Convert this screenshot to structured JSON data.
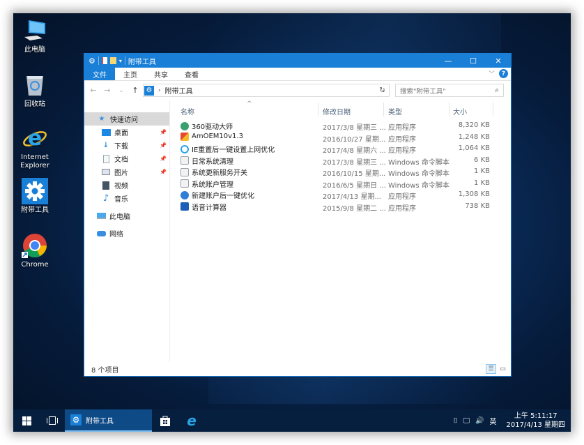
{
  "desktop": {
    "icons": [
      {
        "label": "此电脑",
        "icon": "computer-icon"
      },
      {
        "label": "回收站",
        "icon": "recycle-bin-icon"
      },
      {
        "label": "Internet Explorer",
        "icon": "internet-explorer-icon"
      },
      {
        "label": "附带工具",
        "icon": "gear-icon"
      },
      {
        "label": "Chrome",
        "icon": "chrome-icon"
      }
    ]
  },
  "window": {
    "title": "附带工具",
    "controls": {
      "minimize": "—",
      "maximize": "☐",
      "close": "✕"
    },
    "ribbon_tabs": [
      "文件",
      "主页",
      "共享",
      "查看"
    ],
    "address": {
      "path": [
        "附带工具"
      ],
      "search_placeholder": "搜索\"附带工具\""
    },
    "nav_pane": {
      "items": [
        {
          "label": "快速访问",
          "icon": "star-icon",
          "selected": true,
          "pinned": false
        },
        {
          "label": "桌面",
          "icon": "desktop-icon",
          "pinned": true
        },
        {
          "label": "下载",
          "icon": "download-icon",
          "pinned": true
        },
        {
          "label": "文档",
          "icon": "document-icon",
          "pinned": true
        },
        {
          "label": "图片",
          "icon": "picture-icon",
          "pinned": true
        },
        {
          "label": "视频",
          "icon": "video-icon",
          "pinned": false
        },
        {
          "label": "音乐",
          "icon": "music-icon",
          "pinned": false
        },
        {
          "label": "此电脑",
          "icon": "computer-icon",
          "pinned": false
        },
        {
          "label": "网络",
          "icon": "network-icon",
          "pinned": false
        }
      ]
    },
    "columns": {
      "name": "名称",
      "date": "修改日期",
      "type": "类型",
      "size": "大小"
    },
    "files": [
      {
        "name": "360驱动大师",
        "date": "2017/3/8 星期三 ...",
        "type": "应用程序",
        "size": "8,320 KB",
        "icon": "driver-app-icon"
      },
      {
        "name": "AmOEM10v1.3",
        "date": "2016/10/27 星期...",
        "type": "应用程序",
        "size": "1,248 KB",
        "icon": "oem-app-icon"
      },
      {
        "name": "IE重置后一键设置上网优化",
        "date": "2017/4/8 星期六 ...",
        "type": "应用程序",
        "size": "1,064 KB",
        "icon": "ie-app-icon"
      },
      {
        "name": "日常系统清理",
        "date": "2017/3/8 星期三 ...",
        "type": "Windows 命令脚本",
        "size": "6 KB",
        "icon": "script-icon"
      },
      {
        "name": "系统更新服务开关",
        "date": "2016/10/15 星期...",
        "type": "Windows 命令脚本",
        "size": "1 KB",
        "icon": "script-icon"
      },
      {
        "name": "系统账户管理",
        "date": "2016/6/5 星期日 ...",
        "type": "Windows 命令脚本",
        "size": "1 KB",
        "icon": "script-icon"
      },
      {
        "name": "新建账户后一键优化",
        "date": "2017/4/13 星期...",
        "type": "应用程序",
        "size": "1,308 KB",
        "icon": "account-app-icon"
      },
      {
        "name": "语音计算器",
        "date": "2015/9/8 星期二 ...",
        "type": "应用程序",
        "size": "738 KB",
        "icon": "calculator-app-icon"
      }
    ],
    "status": "8 个项目"
  },
  "taskbar": {
    "app_label": "附带工具",
    "tray": {
      "ime": "英",
      "time": "上午 5:11:17",
      "date": "2017/4/13 星期四"
    }
  },
  "colors": {
    "accent": "#1a7fd6",
    "taskbar": "#061f3e",
    "active_task": "#0e4a86"
  }
}
